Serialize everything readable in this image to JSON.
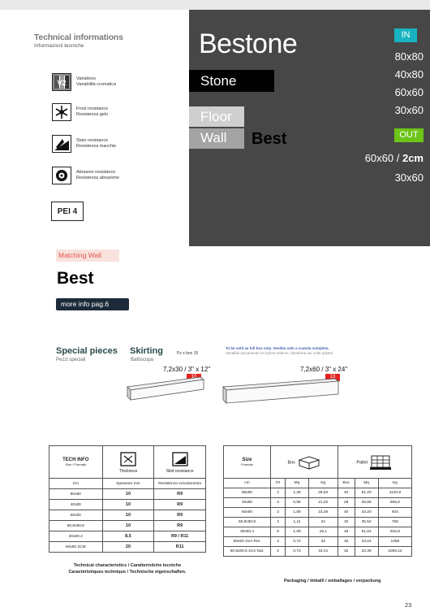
{
  "tech": {
    "title": "Technical informations",
    "subtitle": "Informazioni tecniche",
    "features": [
      {
        "icon": "variation-icon",
        "line1": "Variations",
        "line2": "Variabilità cromatica"
      },
      {
        "icon": "snowflake-icon",
        "line1": "Frost resistance",
        "line2": "Resistenza gelo"
      },
      {
        "icon": "stain-icon",
        "line1": "Stain resistance",
        "line2": "Resistenza macchie"
      },
      {
        "icon": "abrasion-icon",
        "line1": "Abrasion resistance",
        "line2": "Resistenza abrasione"
      }
    ],
    "pei": "PEI 4"
  },
  "panel": {
    "brand": "Bestone",
    "stone": "Stone",
    "floor": "Floor",
    "wall": "Wall",
    "best": "Best",
    "in_label": "IN",
    "in_sizes": [
      "80x80",
      "40x80",
      "60x60",
      "30x60"
    ],
    "out_label": "OUT",
    "out_size_a": "60x60 / ",
    "out_size_b": "2cm",
    "out_size_2": "30x60",
    "colors": {
      "in": "#17b3c1",
      "out": "#6bc417",
      "bg": "#474747"
    }
  },
  "matching": {
    "label": "Matching Wall",
    "name": "Best",
    "more_info": "more info pag.6"
  },
  "special": {
    "title": "Special pieces",
    "subtitle": "Pezzi speciali",
    "skirting_title": "Skirting",
    "skirting_sub": "Battiscopa",
    "pz_box": "Pz x box 15",
    "size1": "7,2x30 / 3\" x 12\"",
    "num1": "10",
    "note1": "To be sold as full box only. Vendita solo a scatola completa.",
    "note2": "Vendible únicamente en bultos enteros. Abnahme nur volle pakete.",
    "size2": "7,2x60 / 3\" x 24\"",
    "num2": "13"
  },
  "tech_table": {
    "head_title": "TECH INFO",
    "head_sub": "Size / Formato",
    "thickness": "Thickness",
    "skid": "Skid resistance",
    "sub_cm": "Cm",
    "sub_spessore": "Spessore mm",
    "sub_resist": "Resistenza scivolamento",
    "rows": [
      [
        "80x80",
        "10",
        "R9"
      ],
      [
        "40x80",
        "10",
        "R9"
      ],
      [
        "60x60",
        "10",
        "R9"
      ],
      [
        "60,8x60,8",
        "10",
        "R9"
      ],
      [
        "30x60,4",
        "8,5",
        "R9 / R11"
      ],
      [
        "60x60 2CM",
        "20",
        "R11"
      ]
    ],
    "caption1": "Technical characteristics / Caratteristiche tecniche",
    "caption2": "Caractéristiques technique / Technische eigenschaften."
  },
  "pack_table": {
    "size": "Size",
    "formato": "Formato",
    "box": "Box",
    "pallet": "Pallet",
    "cols": [
      "cm",
      "Pz",
      "Mq",
      "Kg",
      "Box",
      "Mq",
      "Kg"
    ],
    "rows": [
      [
        "80x80",
        "2",
        "1,28",
        "28,82",
        "40",
        "51,20",
        "1120,8"
      ],
      [
        "40x80",
        "3",
        "0,96",
        "21,02",
        "28",
        "26,88",
        "565,6"
      ],
      [
        "60x60",
        "3",
        "1,08",
        "23,35",
        "40",
        "43,20",
        "934"
      ],
      [
        "60,8x60,8",
        "3",
        "1,11",
        "24",
        "32",
        "35,52",
        "768"
      ],
      [
        "30x60,4",
        "6",
        "1,08",
        "19,1",
        "48",
        "51,84",
        "916,8"
      ],
      [
        "60x60 2cm Ret.",
        "2",
        "0,72",
        "33",
        "32",
        "23,04",
        "1056"
      ],
      [
        "60,5x60,5 2cm Nat.",
        "2",
        "0,73",
        "33,41",
        "32",
        "23,36",
        "1069,12"
      ]
    ],
    "caption": "Packaging / Imballi / emballages / verpackung"
  },
  "page_number": "23"
}
